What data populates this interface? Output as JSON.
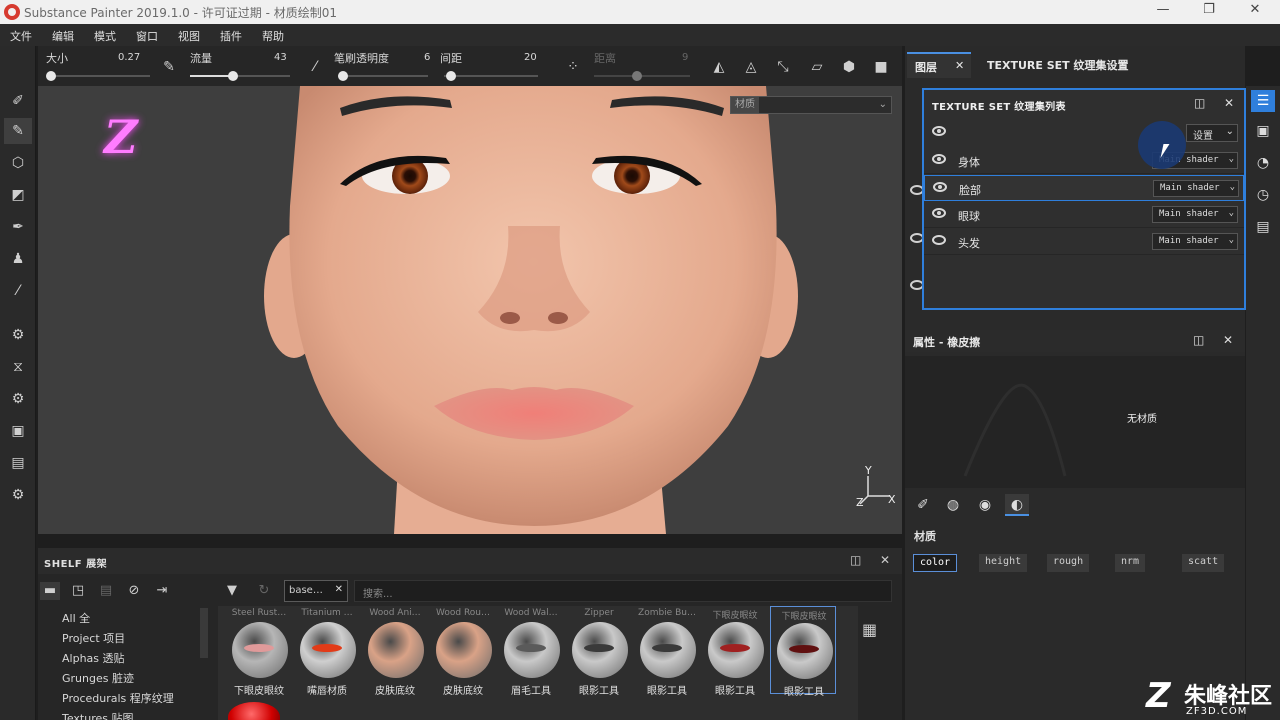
{
  "window": {
    "title": "Substance Painter 2019.1.0 - 许可证过期 - 材质绘制01",
    "minimize": "—",
    "restore": "❐",
    "close": "✕"
  },
  "menu": [
    "文件",
    "编辑",
    "模式",
    "窗口",
    "视图",
    "插件",
    "帮助"
  ],
  "toolbar": {
    "size_label": "大小",
    "size_value": "0.27",
    "flow_label": "流量",
    "flow_value": "43",
    "opacity_label": "笔刷透明度",
    "opacity_value": "6",
    "spacing_label": "间距",
    "spacing_value": "20",
    "distance_label": "距离",
    "distance_value": "9"
  },
  "viewport": {
    "material_label": "材质",
    "gizmo_y": "Y",
    "gizmo_x": "X",
    "gizmo_z": "Z",
    "overlay_logo": "Z"
  },
  "shelf": {
    "title": "SHELF 展架",
    "tag": "base…",
    "search_placeholder": "搜索...",
    "categories": [
      "All 全",
      "Project 项目",
      "Alphas 透贴",
      "Grunges 脏迹",
      "Procedurals 程序纹理",
      "Textures 贴图"
    ],
    "items": [
      {
        "top": "Steel Rust…",
        "name": "下眼皮眼纹",
        "color": "#b6b6b6",
        "accent": "#e09a9a"
      },
      {
        "top": "Titanium …",
        "name": "嘴唇材质",
        "color": "#cfcfcf",
        "accent": "#e23b18"
      },
      {
        "top": "Wood Ani…",
        "name": "皮肤底纹",
        "color": "#d9a287",
        "accent": ""
      },
      {
        "top": "Wood Rou…",
        "name": "皮肤底纹",
        "color": "#d9a287",
        "accent": ""
      },
      {
        "top": "Wood Wal…",
        "name": "眉毛工具",
        "color": "#c9c9c9",
        "accent": "#5a5a5a"
      },
      {
        "top": "Zipper",
        "name": "眼影工具",
        "color": "#c9c9c9",
        "accent": "#3a3a3a"
      },
      {
        "top": "Zombie Bu…",
        "name": "眼影工具",
        "color": "#c9c9c9",
        "accent": "#3a3a3a"
      },
      {
        "top": "下眼皮眼纹",
        "name": "眼影工具",
        "color": "#c9c9c9",
        "accent": "#a02020"
      },
      {
        "top": "下眼皮眼纹",
        "name": "眼影工具",
        "color": "#c9c9c9",
        "accent": "#601010"
      }
    ]
  },
  "layers": {
    "tab_layers": "图层",
    "tab_texset_settings": "TEXTURE SET 纹理集设置",
    "popup_title": "TEXTURE SET 纹理集列表",
    "settings_label": "设置",
    "rows": [
      {
        "name": "身体",
        "shader": "Main shader",
        "visible": true
      },
      {
        "name": "脸部",
        "shader": "Main shader",
        "visible": true
      },
      {
        "name": "眼球",
        "shader": "Main shader",
        "visible": true
      },
      {
        "name": "头发",
        "shader": "Main shader",
        "visible": false
      }
    ]
  },
  "properties": {
    "title": "属性 - 橡皮擦",
    "no_material": "无材质",
    "material_label": "材质",
    "channels": [
      "color",
      "height",
      "rough",
      "nrm",
      "scatt"
    ]
  },
  "watermark": {
    "logo": "Z",
    "brand": "朱峰社区",
    "url": "ZF3D.COM"
  },
  "colors": {
    "accent": "#2f7fdc",
    "skin": "#e8b49a",
    "iris": "#8a3a14",
    "lips": "#e8847a"
  }
}
